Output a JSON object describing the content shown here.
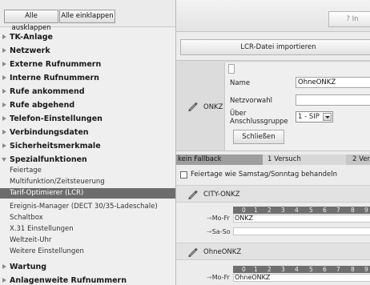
{
  "nav": {
    "buttons": {
      "expand_all": "Alle ausklappen",
      "collapse_all": "Alle einklappen"
    },
    "items": [
      {
        "label": "TK-Anlage"
      },
      {
        "label": "Netzwerk"
      },
      {
        "label": "Externe Rufnummern"
      },
      {
        "label": "Interne Rufnummern"
      },
      {
        "label": "Rufe ankommend"
      },
      {
        "label": "Rufe abgehend"
      },
      {
        "label": "Telefon-Einstellungen"
      },
      {
        "label": "Verbindungsdaten"
      },
      {
        "label": "Sicherheitsmerkmale"
      },
      {
        "label": "Spezialfunktionen",
        "expanded": true
      }
    ],
    "subitems": [
      {
        "label": "Feiertage"
      },
      {
        "label": "Multifunktion/Zeitsteuerung"
      },
      {
        "label": "Tarif-Optimierer (LCR)",
        "active": true
      },
      {
        "label": "Ereignis-Manager (DECT 30/35-Ladeschale)"
      },
      {
        "label": "Schaltbox"
      },
      {
        "label": "X.31 Einstellungen"
      },
      {
        "label": "Weltzeit-Uhr"
      },
      {
        "label": "Weitere Einstellungen"
      }
    ],
    "bottom_items": [
      {
        "label": "Wartung"
      },
      {
        "label": "Anlagenweite Rufnummern"
      }
    ]
  },
  "main": {
    "help_button": "? In",
    "import_button": "LCR-Datei importieren",
    "editor": {
      "label": "ONKZ",
      "fields": {
        "name_label": "Name",
        "name_value": "OhneONKZ",
        "prefix_label": "Netzvorwahl",
        "prefix_value": "",
        "line_group_label_1": "Über",
        "line_group_label_2": "Anschlussgruppe",
        "line_group_value": "1 - SIP"
      },
      "close_button": "Schließen"
    },
    "fallback": {
      "col1": "kein Fallback",
      "col2": "1 Versuch",
      "col3": "2 Ver"
    },
    "holiday_checkbox": {
      "label": "Feiertage wie Samstag/Sonntag behandeln",
      "checked": false
    },
    "hours": [
      "0",
      "1",
      "2",
      "3",
      "4",
      "5",
      "6",
      "7",
      "8",
      "9"
    ],
    "providers": [
      {
        "name": "CITY-ONKZ",
        "rows": [
          {
            "label": "Mo-Fr",
            "value": "ONKZ"
          },
          {
            "label": "Sa-So",
            "value": ""
          }
        ]
      },
      {
        "name": "OhneONKZ",
        "rows": [
          {
            "label": "Mo-Fr",
            "value": "OhneONKZ"
          }
        ]
      }
    ],
    "row_arrow": "→"
  }
}
